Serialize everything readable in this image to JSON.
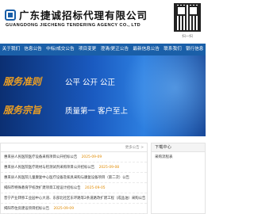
{
  "header": {
    "company_cn": "广东捷诚招标代理有限公司",
    "company_en": "GUANGDONG JIECHENG TENDERING AGENCY CO., LTD",
    "qr_caption": "扫一扫"
  },
  "nav": {
    "items": [
      "关于我们",
      "信息公告",
      "中标/成交公告",
      "项目变更",
      "澄清/更正公告",
      "最新信息公告",
      "联系我们",
      "银行信息"
    ]
  },
  "banner": {
    "line1_title": "服务准则",
    "line1_sub": "公平 公开 公正",
    "line2_title": "服务宗旨",
    "line2_sub": "质量第一 客户至上"
  },
  "news": {
    "more_label": "更多公告 >",
    "items": [
      {
        "title": "惠来县人民医院医疗设备采购项目公开招标公告",
        "date": "2025-09-09"
      },
      {
        "title": "惠来县人民医院医疗耗材与检测试剂采购项目公开招标公告",
        "date": "2025-09-08"
      },
      {
        "title": "惠来县人民医院儿童康复中心医疗设备及家具采购与康复设备项目（第二次）公告",
        "date": ""
      },
      {
        "title": "揭阳市特殊教育学校改扩建项目工程设计招标公告",
        "date": "2025-09-05"
      },
      {
        "title": "普宁产业转移工业园中心大道、东部北社区东环路等2条道路改扩建工程（成品油）采购公告",
        "date": ""
      },
      {
        "title": "揭阳市住房建设项目招标公告",
        "date": "2025-09-09"
      }
    ]
  },
  "downloads": {
    "title": "下载中心",
    "items": [
      "采购流程表"
    ]
  }
}
